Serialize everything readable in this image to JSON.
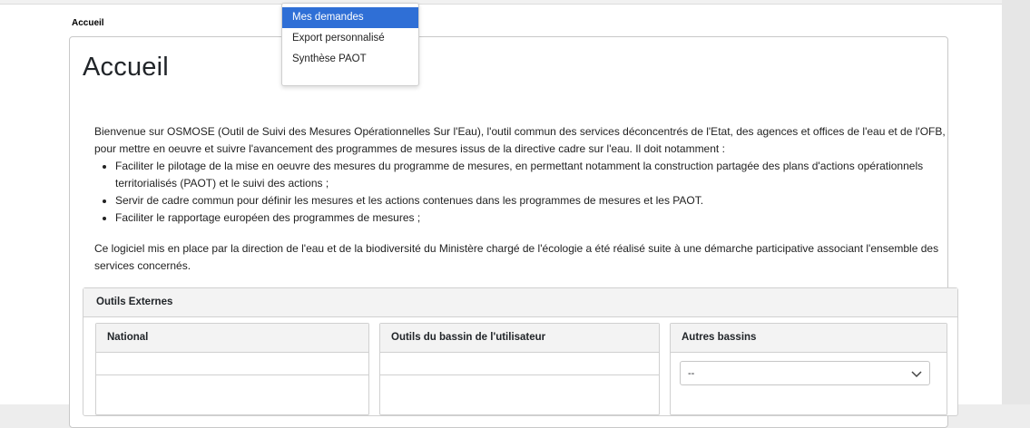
{
  "breadcrumb": {
    "current": "Accueil"
  },
  "page": {
    "title": "Accueil"
  },
  "intro": {
    "paragraph1": "Bienvenue sur OSMOSE (Outil de Suivi des Mesures Opérationnelles Sur l'Eau), l'outil commun des services déconcentrés de l'Etat, des agences et offices de l'eau et de l'OFB, pour mettre en oeuvre et suivre l'avancement des programmes de mesures issus de la directive cadre sur l'eau. Il doit notamment :",
    "bullets": [
      "Faciliter le pilotage de la mise en oeuvre des mesures du programme de mesures, en permettant notamment la construction partagée des plans d'actions opérationnels territorialisés (PAOT) et le suivi des actions ;",
      "Servir de cadre commun pour définir les mesures et les actions contenues dans les programmes de mesures et les PAOT.",
      "Faciliter le rapportage européen des programmes de mesures ;"
    ],
    "paragraph2": "Ce logiciel mis en place par la direction de l'eau et de la biodiversité du Ministère chargé de l'écologie a été réalisé suite à une démarche participative associant l'ensemble des services concernés."
  },
  "outils": {
    "title": "Outils Externes",
    "national": {
      "title": "National"
    },
    "bassin_utilisateur": {
      "title": "Outils du bassin de l'utilisateur"
    },
    "autres_bassins": {
      "title": "Autres bassins",
      "select_value": "--"
    }
  },
  "dropdown_menu": {
    "items": [
      {
        "label": "Mes demandes",
        "active": true
      },
      {
        "label": "Export personnalisé",
        "active": false
      },
      {
        "label": "Synthèse PAOT",
        "active": false
      }
    ]
  },
  "colors": {
    "active_item": "#2f6fd6",
    "header_bg": "#f3f3f3",
    "border": "#d0d0d0"
  },
  "icons": {
    "select_arrow": "chevron-down-icon"
  }
}
